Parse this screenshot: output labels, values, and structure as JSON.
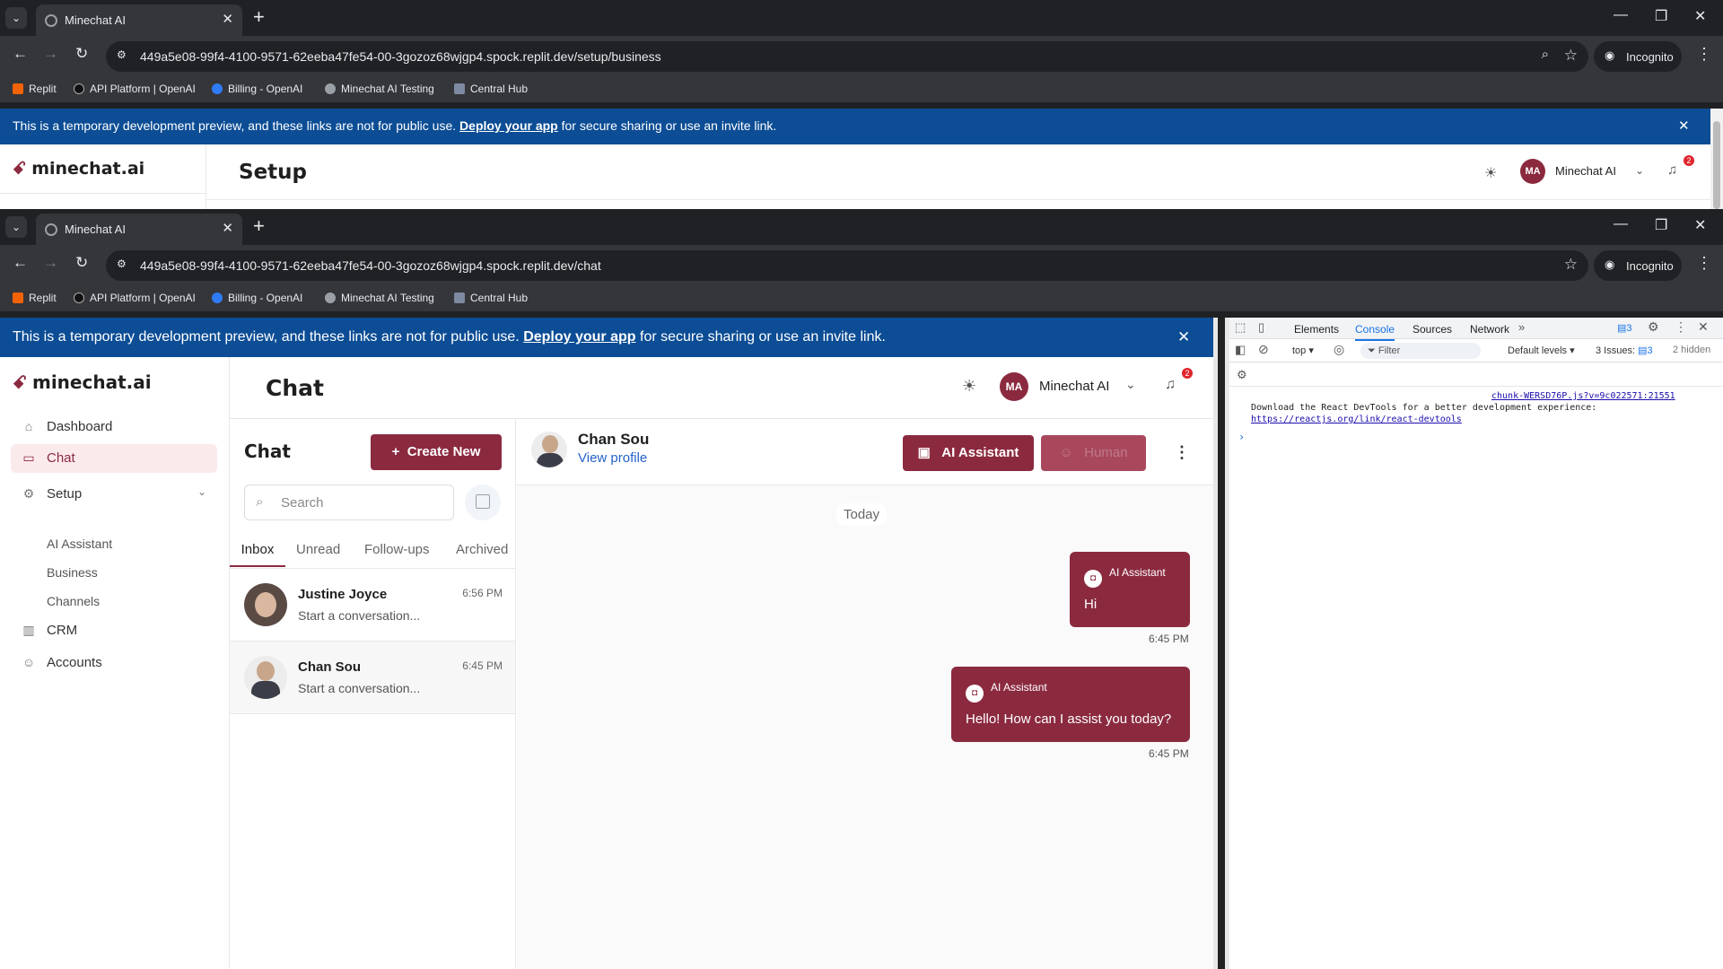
{
  "browser": {
    "tab_title": "Minechat AI",
    "incognito_label": "Incognito",
    "bookmarks": [
      "Replit",
      "API Platform | OpenAI",
      "Billing - OpenAI",
      "Minechat AI Testing",
      "Central Hub"
    ]
  },
  "window_back": {
    "url": "449a5e08-99f4-4100-9571-62eeba47fe54-00-3gozoz68wjgp4.spock.replit.dev/setup/business",
    "page_title": "Setup"
  },
  "window_front": {
    "url": "449a5e08-99f4-4100-9571-62eeba47fe54-00-3gozoz68wjgp4.spock.replit.dev/chat",
    "page_title": "Chat"
  },
  "banner": {
    "text_before": "This is a temporary development preview, and these links are not for public use.",
    "link": "Deploy your app",
    "text_after": "for secure sharing or use an invite link."
  },
  "app": {
    "logo": "minechat.ai",
    "user_initials": "MA",
    "user_name": "Minechat AI",
    "notification_count": "2",
    "sidebar": {
      "dashboard": "Dashboard",
      "chat": "Chat",
      "setup": "Setup",
      "setup_children": [
        "AI Assistant",
        "Business",
        "Channels"
      ],
      "crm": "CRM",
      "accounts": "Accounts"
    },
    "chat_list": {
      "title": "Chat",
      "create_new": "Create New",
      "search_placeholder": "Search",
      "tabs": [
        "Inbox",
        "Unread",
        "Follow-ups",
        "Archived"
      ],
      "conversations": [
        {
          "name": "Justine Joyce",
          "preview": "Start a conversation...",
          "time": "6:56 PM"
        },
        {
          "name": "Chan Sou",
          "preview": "Start a conversation...",
          "time": "6:45 PM"
        }
      ]
    },
    "conversation": {
      "contact_name": "Chan Sou",
      "view_profile": "View profile",
      "ai_assistant_button": "AI Assistant",
      "human_button": "Human",
      "date_separator": "Today",
      "messages": [
        {
          "sender": "AI Assistant",
          "text": "Hi",
          "time": "6:45 PM"
        },
        {
          "sender": "AI Assistant",
          "text": "Hello! How can I assist you today?",
          "time": "6:45 PM"
        }
      ]
    }
  },
  "devtools": {
    "tabs": [
      "Elements",
      "Console",
      "Sources",
      "Network"
    ],
    "issues_badge": "3",
    "context": "top",
    "filter_placeholder": "Filter",
    "levels": "Default levels",
    "issues": "3 Issues:",
    "issues_count": "3",
    "hidden": "2 hidden",
    "log_source": "chunk-WERSD76P.js?v=9c022571:21551",
    "log_text": "Download the React DevTools for a better development experience:",
    "log_link": "https://reactjs.org/link/react-devtools",
    "prompt": "›"
  }
}
